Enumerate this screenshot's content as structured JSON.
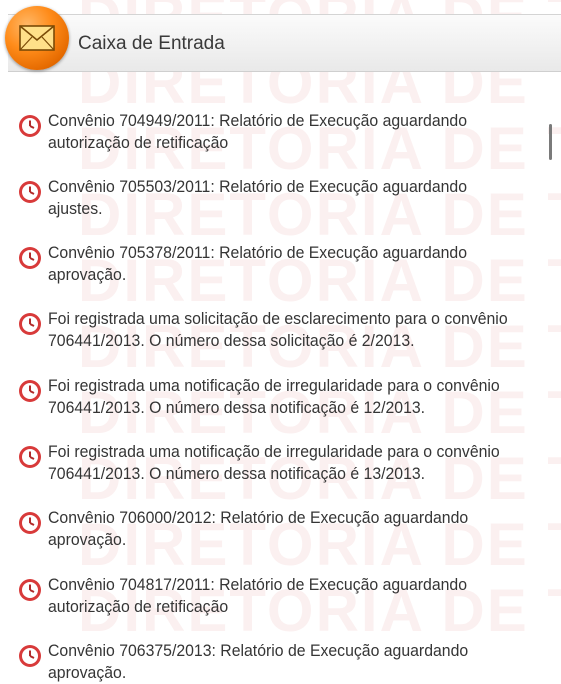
{
  "watermark": {
    "lines": [
      "DIRETORIA DE TR",
      "DIRETORIA DE TR",
      "DIRETORIA DE TR",
      "DIRETORIA DE TR",
      "DIRETORIA DE TR",
      "DIRETORIA DE TR",
      "DIRETORIA DE TR",
      "DIRETORIA DE TR",
      "DIRETORIA DE TR",
      "DIRETORIA DE TR"
    ]
  },
  "header": {
    "title": "Caixa de Entrada",
    "icon": "envelope-icon",
    "icon_color": "#ff8c1a"
  },
  "messages": [
    {
      "text": "Convênio 704949/2011: Relatório de Execução aguardando autorização de retificação",
      "icon": "clock-icon"
    },
    {
      "text": "Convênio 705503/2011: Relatório de Execução aguardando ajustes.",
      "icon": "clock-icon"
    },
    {
      "text": "Convênio 705378/2011: Relatório de Execução aguardando aprovação.",
      "icon": "clock-icon"
    },
    {
      "text": "Foi registrada uma solicitação de esclarecimento para o convênio 706441/2013. O número dessa solicitação é 2/2013.",
      "icon": "clock-icon"
    },
    {
      "text": "Foi registrada uma notificação de irregularidade para o convênio 706441/2013. O número dessa notificação é 12/2013.",
      "icon": "clock-icon"
    },
    {
      "text": "Foi registrada uma notificação de irregularidade para o convênio 706441/2013. O número dessa notificação é 13/2013.",
      "icon": "clock-icon"
    },
    {
      "text": "Convênio 706000/2012: Relatório de Execução aguardando aprovação.",
      "icon": "clock-icon"
    },
    {
      "text": "Convênio 704817/2011: Relatório de Execução aguardando autorização de retificação",
      "icon": "clock-icon"
    },
    {
      "text": "Convênio 706375/2013: Relatório de Execução aguardando aprovação.",
      "icon": "clock-icon"
    }
  ],
  "colors": {
    "clock_icon": "#d83a3a",
    "watermark": "#cd2828"
  }
}
